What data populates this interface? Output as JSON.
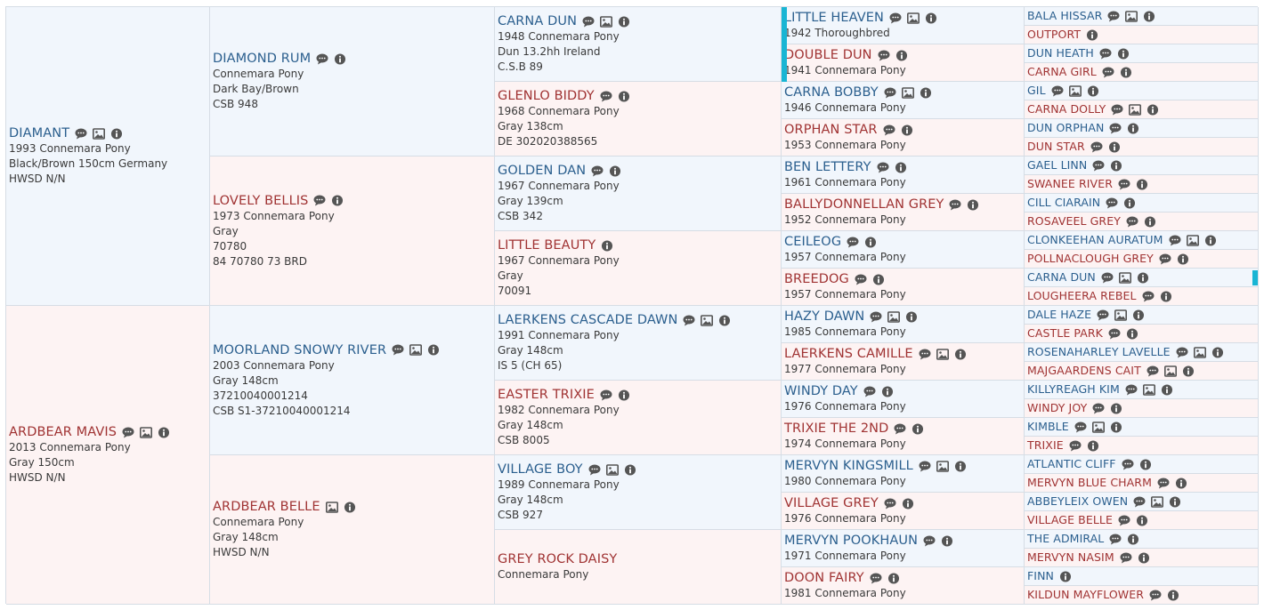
{
  "colors": {
    "sire_name": "#2b5f8e",
    "dam_name": "#a03333",
    "sire_bg": "#f1f6fc",
    "dam_bg": "#fdf3f3",
    "highlight": "#19b5d4"
  },
  "pedigree": {
    "gen0": [
      {
        "sex": "sire",
        "name": "DIAMANT",
        "info": [
          "1993 Connemara Pony",
          "Black/Brown 150cm Germany",
          "HWSD N/N"
        ],
        "icons": [
          "comment-icon",
          "photo-icon",
          "info-icon"
        ]
      },
      {
        "sex": "dam",
        "name": "ARDBEAR MAVIS",
        "info": [
          "2013 Connemara Pony",
          "Gray 150cm",
          "HWSD N/N"
        ],
        "icons": [
          "comment-icon",
          "photo-icon",
          "info-icon"
        ]
      }
    ],
    "gen1": [
      {
        "sex": "sire",
        "name": "DIAMOND RUM",
        "info": [
          "Connemara Pony",
          "Dark Bay/Brown",
          "CSB 948"
        ],
        "icons": [
          "comment-icon",
          "info-icon"
        ]
      },
      {
        "sex": "dam",
        "name": "LOVELY BELLIS",
        "info": [
          "1973 Connemara Pony",
          "Gray",
          "70780",
          "84 70780 73 BRD"
        ],
        "icons": [
          "comment-icon",
          "info-icon"
        ]
      },
      {
        "sex": "sire",
        "name": "MOORLAND SNOWY RIVER",
        "info": [
          "2003 Connemara Pony",
          "Gray 148cm",
          "37210040001214",
          "CSB S1-37210040001214"
        ],
        "icons": [
          "comment-icon",
          "photo-icon",
          "info-icon"
        ]
      },
      {
        "sex": "dam",
        "name": "ARDBEAR BELLE",
        "info": [
          "Connemara Pony",
          "Gray 148cm",
          "HWSD N/N"
        ],
        "icons": [
          "photo-icon",
          "info-icon"
        ]
      }
    ],
    "gen2": [
      {
        "sex": "sire",
        "name": "CARNA DUN",
        "info": [
          "1948 Connemara Pony",
          "Dun 13.2hh Ireland",
          "C.S.B 89"
        ],
        "icons": [
          "comment-icon",
          "photo-icon",
          "info-icon"
        ]
      },
      {
        "sex": "dam",
        "name": "GLENLO BIDDY",
        "info": [
          "1968 Connemara Pony",
          "Gray 138cm",
          "DE 302020388565"
        ],
        "icons": [
          "comment-icon",
          "info-icon"
        ]
      },
      {
        "sex": "sire",
        "name": "GOLDEN DAN",
        "info": [
          "1967 Connemara Pony",
          "Gray 139cm",
          "CSB 342"
        ],
        "icons": [
          "comment-icon",
          "info-icon"
        ]
      },
      {
        "sex": "dam",
        "name": "LITTLE BEAUTY",
        "info": [
          "1967 Connemara Pony",
          "Gray",
          "70091"
        ],
        "icons": [
          "info-icon"
        ]
      },
      {
        "sex": "sire",
        "name": "LAERKENS CASCADE DAWN",
        "info": [
          "1991 Connemara Pony",
          "Gray 148cm",
          "IS 5 (CH 65)"
        ],
        "icons": [
          "comment-icon",
          "photo-icon",
          "info-icon"
        ]
      },
      {
        "sex": "dam",
        "name": "EASTER TRIXIE",
        "info": [
          "1982 Connemara Pony",
          "Gray 148cm",
          "CSB 8005"
        ],
        "icons": [
          "comment-icon",
          "info-icon"
        ]
      },
      {
        "sex": "sire",
        "name": "VILLAGE BOY",
        "info": [
          "1989 Connemara Pony",
          "Gray 148cm",
          "CSB 927"
        ],
        "icons": [
          "comment-icon",
          "photo-icon",
          "info-icon"
        ]
      },
      {
        "sex": "dam",
        "name": "GREY ROCK DAISY",
        "info": [
          "Connemara Pony"
        ],
        "icons": []
      }
    ],
    "gen3": [
      {
        "sex": "sire",
        "name": "LITTLE HEAVEN",
        "info": [
          "1942 Thoroughbred"
        ],
        "icons": [
          "comment-icon",
          "photo-icon",
          "info-icon"
        ]
      },
      {
        "sex": "dam",
        "name": "DOUBLE DUN",
        "info": [
          "1941 Connemara Pony"
        ],
        "icons": [
          "comment-icon",
          "info-icon"
        ]
      },
      {
        "sex": "sire",
        "name": "CARNA BOBBY",
        "info": [
          "1946 Connemara Pony"
        ],
        "icons": [
          "comment-icon",
          "photo-icon",
          "info-icon"
        ]
      },
      {
        "sex": "dam",
        "name": "ORPHAN STAR",
        "info": [
          "1953 Connemara Pony"
        ],
        "icons": [
          "comment-icon",
          "info-icon"
        ]
      },
      {
        "sex": "sire",
        "name": "BEN LETTERY",
        "info": [
          "1961 Connemara Pony"
        ],
        "icons": [
          "comment-icon",
          "info-icon"
        ]
      },
      {
        "sex": "dam",
        "name": "BALLYDONNELLAN GREY",
        "info": [
          "1952 Connemara Pony"
        ],
        "icons": [
          "comment-icon",
          "info-icon"
        ]
      },
      {
        "sex": "sire",
        "name": "CEILEOG",
        "info": [
          "1957 Connemara Pony"
        ],
        "icons": [
          "comment-icon",
          "info-icon"
        ]
      },
      {
        "sex": "dam",
        "name": "BREEDOG",
        "info": [
          "1957 Connemara Pony"
        ],
        "icons": [
          "comment-icon",
          "info-icon"
        ]
      },
      {
        "sex": "sire",
        "name": "HAZY DAWN",
        "info": [
          "1985 Connemara Pony"
        ],
        "icons": [
          "comment-icon",
          "photo-icon",
          "info-icon"
        ]
      },
      {
        "sex": "dam",
        "name": "LAERKENS CAMILLE",
        "info": [
          "1977 Connemara Pony"
        ],
        "icons": [
          "comment-icon",
          "photo-icon",
          "info-icon"
        ]
      },
      {
        "sex": "sire",
        "name": "WINDY DAY",
        "info": [
          "1976 Connemara Pony"
        ],
        "icons": [
          "comment-icon",
          "info-icon"
        ]
      },
      {
        "sex": "dam",
        "name": "TRIXIE THE 2ND",
        "info": [
          "1974 Connemara Pony"
        ],
        "icons": [
          "comment-icon",
          "info-icon"
        ]
      },
      {
        "sex": "sire",
        "name": "MERVYN KINGSMILL",
        "info": [
          "1980 Connemara Pony"
        ],
        "icons": [
          "comment-icon",
          "photo-icon",
          "info-icon"
        ]
      },
      {
        "sex": "dam",
        "name": "VILLAGE GREY",
        "info": [
          "1976 Connemara Pony"
        ],
        "icons": [
          "comment-icon",
          "info-icon"
        ]
      },
      {
        "sex": "sire",
        "name": "MERVYN POOKHAUN",
        "info": [
          "1971 Connemara Pony"
        ],
        "icons": [
          "comment-icon",
          "info-icon"
        ]
      },
      {
        "sex": "dam",
        "name": "DOON FAIRY",
        "info": [
          "1981 Connemara Pony"
        ],
        "icons": [
          "comment-icon",
          "info-icon"
        ]
      }
    ],
    "gen4": [
      {
        "sex": "sire",
        "name": "BALA HISSAR",
        "info": [],
        "icons": [
          "comment-icon",
          "photo-icon",
          "info-icon"
        ]
      },
      {
        "sex": "dam",
        "name": "OUTPORT",
        "info": [],
        "icons": [
          "info-icon"
        ]
      },
      {
        "sex": "sire",
        "name": "DUN HEATH",
        "info": [],
        "icons": [
          "comment-icon",
          "info-icon"
        ]
      },
      {
        "sex": "dam",
        "name": "CARNA GIRL",
        "info": [],
        "icons": [
          "comment-icon",
          "info-icon"
        ]
      },
      {
        "sex": "sire",
        "name": "GIL",
        "info": [],
        "icons": [
          "comment-icon",
          "photo-icon",
          "info-icon"
        ]
      },
      {
        "sex": "dam",
        "name": "CARNA DOLLY",
        "info": [],
        "icons": [
          "comment-icon",
          "photo-icon",
          "info-icon"
        ]
      },
      {
        "sex": "sire",
        "name": "DUN ORPHAN",
        "info": [],
        "icons": [
          "comment-icon",
          "info-icon"
        ]
      },
      {
        "sex": "dam",
        "name": "DUN STAR",
        "info": [],
        "icons": [
          "comment-icon",
          "info-icon"
        ]
      },
      {
        "sex": "sire",
        "name": "GAEL LINN",
        "info": [],
        "icons": [
          "comment-icon",
          "info-icon"
        ]
      },
      {
        "sex": "dam",
        "name": "SWANEE RIVER",
        "info": [],
        "icons": [
          "comment-icon",
          "info-icon"
        ]
      },
      {
        "sex": "sire",
        "name": "CILL CIARAIN",
        "info": [],
        "icons": [
          "comment-icon",
          "info-icon"
        ]
      },
      {
        "sex": "dam",
        "name": "ROSAVEEL GREY",
        "info": [],
        "icons": [
          "comment-icon",
          "info-icon"
        ]
      },
      {
        "sex": "sire",
        "name": "CLONKEEHAN AURATUM",
        "info": [],
        "icons": [
          "comment-icon",
          "photo-icon",
          "info-icon"
        ]
      },
      {
        "sex": "dam",
        "name": "POLLNACLOUGH GREY",
        "info": [],
        "icons": [
          "comment-icon",
          "info-icon"
        ]
      },
      {
        "sex": "sire",
        "name": "CARNA DUN",
        "info": [],
        "icons": [
          "comment-icon",
          "photo-icon",
          "info-icon"
        ]
      },
      {
        "sex": "dam",
        "name": "LOUGHEERA REBEL",
        "info": [],
        "icons": [
          "comment-icon",
          "info-icon"
        ]
      },
      {
        "sex": "sire",
        "name": "DALE HAZE",
        "info": [],
        "icons": [
          "comment-icon",
          "photo-icon",
          "info-icon"
        ]
      },
      {
        "sex": "dam",
        "name": "CASTLE PARK",
        "info": [],
        "icons": [
          "comment-icon",
          "info-icon"
        ]
      },
      {
        "sex": "sire",
        "name": "ROSENAHARLEY LAVELLE",
        "info": [],
        "icons": [
          "comment-icon",
          "photo-icon",
          "info-icon"
        ]
      },
      {
        "sex": "dam",
        "name": "MAJGAARDENS CAIT",
        "info": [],
        "icons": [
          "comment-icon",
          "photo-icon",
          "info-icon"
        ]
      },
      {
        "sex": "sire",
        "name": "KILLYREAGH KIM",
        "info": [],
        "icons": [
          "comment-icon",
          "photo-icon",
          "info-icon"
        ]
      },
      {
        "sex": "dam",
        "name": "WINDY JOY",
        "info": [],
        "icons": [
          "comment-icon",
          "info-icon"
        ]
      },
      {
        "sex": "sire",
        "name": "KIMBLE",
        "info": [],
        "icons": [
          "comment-icon",
          "photo-icon",
          "info-icon"
        ]
      },
      {
        "sex": "dam",
        "name": "TRIXIE",
        "info": [],
        "icons": [
          "comment-icon",
          "info-icon"
        ]
      },
      {
        "sex": "sire",
        "name": "ATLANTIC CLIFF",
        "info": [],
        "icons": [
          "comment-icon",
          "info-icon"
        ]
      },
      {
        "sex": "dam",
        "name": "MERVYN BLUE CHARM",
        "info": [],
        "icons": [
          "comment-icon",
          "info-icon"
        ]
      },
      {
        "sex": "sire",
        "name": "ABBEYLEIX OWEN",
        "info": [],
        "icons": [
          "comment-icon",
          "photo-icon",
          "info-icon"
        ]
      },
      {
        "sex": "dam",
        "name": "VILLAGE BELLE",
        "info": [],
        "icons": [
          "comment-icon",
          "info-icon"
        ]
      },
      {
        "sex": "sire",
        "name": "THE ADMIRAL",
        "info": [],
        "icons": [
          "comment-icon",
          "info-icon"
        ]
      },
      {
        "sex": "dam",
        "name": "MERVYN NASIM",
        "info": [],
        "icons": [
          "comment-icon",
          "info-icon"
        ]
      },
      {
        "sex": "sire",
        "name": "FINN",
        "info": [],
        "icons": [
          "info-icon"
        ]
      },
      {
        "sex": "dam",
        "name": "KILDUN MAYFLOWER",
        "info": [],
        "icons": [
          "comment-icon",
          "info-icon"
        ]
      }
    ]
  }
}
